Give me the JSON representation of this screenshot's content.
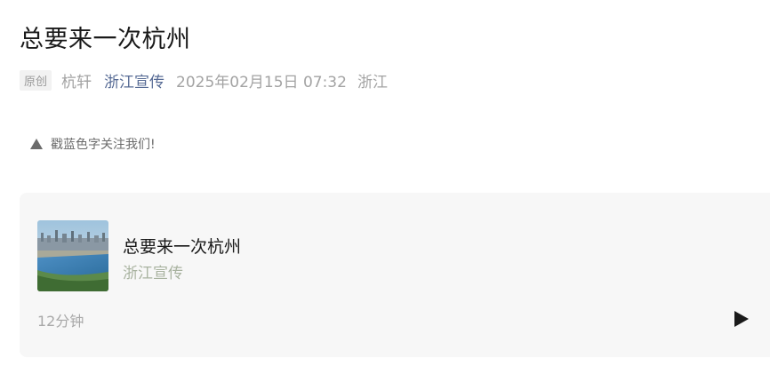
{
  "article": {
    "title": "总要来一次杭州",
    "original_badge": "原创",
    "author": "杭轩",
    "account_name": "浙江宣传",
    "publish_time": "2025年02月15日 07:32",
    "location": "浙江"
  },
  "follow_hint": {
    "icon": "triangle-up-icon",
    "text": "戳蓝色字关注我们!"
  },
  "media_card": {
    "title": "总要来一次杭州",
    "source": "浙江宣传",
    "duration": "12分钟",
    "cover_description_icon": "city-lake-cover-image",
    "play_icon": "play-icon"
  },
  "colors": {
    "link_blue": "#576b95",
    "meta_gray": "#a3a3a3",
    "card_background": "#f7f7f7",
    "card_source_green": "#a9b3a0"
  }
}
